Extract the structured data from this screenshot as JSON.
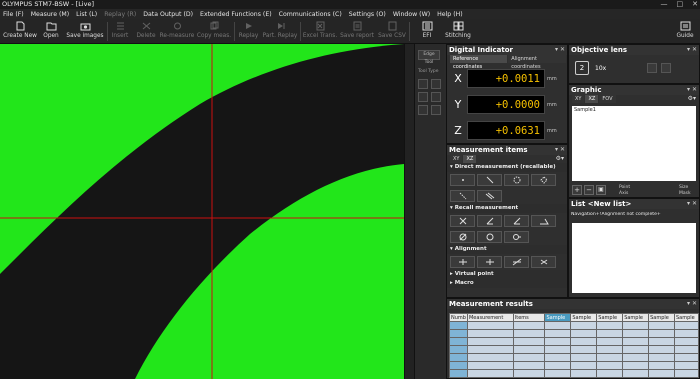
{
  "window": {
    "title": "OLYMPUS   STM7-BSW - [Live]",
    "controls": [
      "—",
      "□",
      "✕"
    ]
  },
  "menu": [
    {
      "label": "File (F)",
      "enabled": true
    },
    {
      "label": "Measure (M)",
      "enabled": true
    },
    {
      "label": "List (L)",
      "enabled": true
    },
    {
      "label": "Replay (R)",
      "enabled": false
    },
    {
      "label": "Data Output (D)",
      "enabled": true
    },
    {
      "label": "Extended Functions (E)",
      "enabled": true
    },
    {
      "label": "Communications (C)",
      "enabled": true
    },
    {
      "label": "Settings (O)",
      "enabled": true
    },
    {
      "label": "Window (W)",
      "enabled": true
    },
    {
      "label": "Help (H)",
      "enabled": true
    }
  ],
  "toolbar": {
    "create_new": "Create New",
    "open": "Open",
    "save_images": "Save images",
    "insert": "Insert",
    "delete": "Delete",
    "remeasure": "Re-measure",
    "copy_meas": "Copy meas.",
    "replay": "Replay",
    "part_replay": "Part. Replay",
    "excel_trans": "Excel Trans.",
    "save_report": "Save report",
    "save_csv": "Save CSV",
    "efi": "EFI",
    "stitching": "Stitching",
    "guide": "Guide"
  },
  "side_tools": {
    "edge_button": "Edge Tool",
    "tool_type": "Tool Type"
  },
  "digital_indicator": {
    "title": "Digital Indicator",
    "tabs": [
      "Reference coordinates",
      "Alignment coordinates"
    ],
    "active_tab": 0,
    "axes": [
      {
        "label": "X",
        "value": "+0.0011",
        "unit": "mm"
      },
      {
        "label": "Y",
        "value": "+0.0000",
        "unit": "mm"
      },
      {
        "label": "Z",
        "value": "+0.0631",
        "unit": "mm"
      }
    ]
  },
  "objective_lens": {
    "title": "Objective lens",
    "number": "2",
    "magnification": "10x"
  },
  "graphic": {
    "title": "Graphic",
    "tabs": [
      "XY",
      "XZ",
      "FOV"
    ],
    "active_tab": 1,
    "sample_label": "Sample1",
    "point_label": "Point",
    "axis_label": "Axis",
    "size_label": "Size",
    "mask_label": "Mask"
  },
  "list": {
    "title": "List <New list>",
    "navigation_text": "Navigation+!Alignment not complete+"
  },
  "measurement_items": {
    "title": "Measurement items",
    "tabs": [
      "XY",
      "XZ"
    ],
    "active_tab": 1,
    "sections": [
      "Direct measurement (recallable)",
      "Recall measurement",
      "Alignment",
      "Virtual point",
      "Macro"
    ]
  },
  "measurement_results": {
    "title": "Measurement results",
    "columns": [
      "Numb",
      "Measurement",
      "Items",
      "Sample",
      "Sample",
      "Sample",
      "Sample",
      "Sample",
      "Sample"
    ]
  },
  "colors": {
    "live_green": "#22e61a",
    "crosshair": "#cc1010",
    "indicator_value": "#f5c000"
  }
}
